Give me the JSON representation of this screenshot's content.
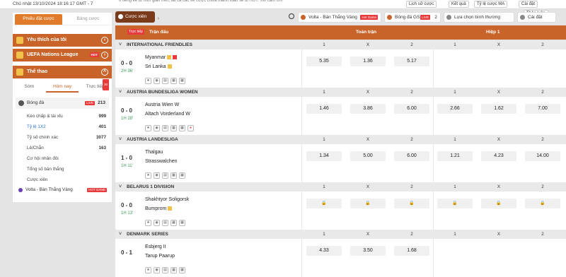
{
  "topbar": {
    "time": "Chủ nhật 13/10/2024 18:16:17 GMT - 7",
    "notice": "6 tiếng kể từ thời gian trên, tất cả các vé cược chưa thanh toán sẽ bị HỦY. Xin cảm ơn!",
    "history": "Lịch sử cược",
    "results": "Kết quả",
    "odds": "Tỷ lệ cược MA",
    "settings": "Cài đặt",
    "discuss": "Thảo luận"
  },
  "left": {
    "tab_bet": "Phiếu đặt cược",
    "tab_board": "Bảng cược",
    "fav": "Yêu thích của tôi",
    "nations": "UEFA Nations League",
    "hot": "HOT",
    "sport": "Thể thao",
    "sub_early": "Sớm",
    "sub_today": "Hôm nay",
    "sub_live": "Trực tiếp",
    "live_count": "30",
    "football": "Bóng đá",
    "football_live": "LIVE",
    "football_count": "213",
    "markets": [
      {
        "label": "Kèo chấp & tài xỉu",
        "count": "999"
      },
      {
        "label": "Tỷ lệ 1X2",
        "count": "401"
      },
      {
        "label": "Tỷ số chính xác",
        "count": "3077"
      },
      {
        "label": "Lẻ/Chẵn",
        "count": "163"
      },
      {
        "label": "Cơ hội nhân đôi",
        "count": ""
      },
      {
        "label": "Tổng số bàn thắng",
        "count": ""
      },
      {
        "label": "Cược xiên",
        "count": ""
      }
    ],
    "volta": "Volta - Bàn Thắng Vàng",
    "volta_tag": "HOT GAME"
  },
  "main": {
    "cx": "Cược xiên",
    "volta": "Volta - Bàn Thắng Vàng",
    "volta_tag": "Hot Game",
    "gs": "Bóng đá GS",
    "gs_tag": "LIVE",
    "gs_count": "2",
    "select": "Lựa chọn bình thường",
    "settings": "Cài đặt",
    "head": {
      "live": "Trực tiếp",
      "match": "Trận đấu",
      "full": "Toàn trận",
      "half": "Hiệp 1"
    },
    "cols": [
      "1",
      "X",
      "2",
      "1",
      "X",
      "2"
    ],
    "leagues": [
      {
        "name": "INTERNATIONAL FRIENDLIES",
        "score": "0 - 0",
        "time": "2H 36'",
        "home": "Myanmar",
        "away": "Sri Lanka",
        "odds": [
          "5.35",
          "1.36",
          "5.17",
          "",
          "",
          ""
        ]
      },
      {
        "name": "AUSTRIA BUNDESLIGA WOMEN",
        "score": "0 - 0",
        "time": "1H 28'",
        "home": "Austria Wien W",
        "away": "Altach Vorderland W",
        "odds": [
          "1.46",
          "3.86",
          "6.00",
          "2.66",
          "1.62",
          "7.00"
        ]
      },
      {
        "name": "AUSTRIA LANDESLIGA",
        "score": "1 - 0",
        "time": "1H 11'",
        "home": "Thalgau",
        "away": "Strasswalchen",
        "odds": [
          "1.34",
          "5.00",
          "6.00",
          "1.21",
          "4.23",
          "14.00"
        ]
      },
      {
        "name": "BELARUS 1 DIVISION",
        "score": "0 - 0",
        "time": "1H 13'",
        "home": "Shakhtyor Soligorsk",
        "away": "Bumprom",
        "odds": [
          "",
          "",
          "",
          "",
          "",
          ""
        ]
      },
      {
        "name": "DENMARK SERIES",
        "score": "0 - 1",
        "time": "",
        "home": "Esbjerg II",
        "away": "Tarup Paarup",
        "odds": [
          "4.33",
          "3.50",
          "1.68",
          "",
          "",
          ""
        ]
      }
    ]
  }
}
